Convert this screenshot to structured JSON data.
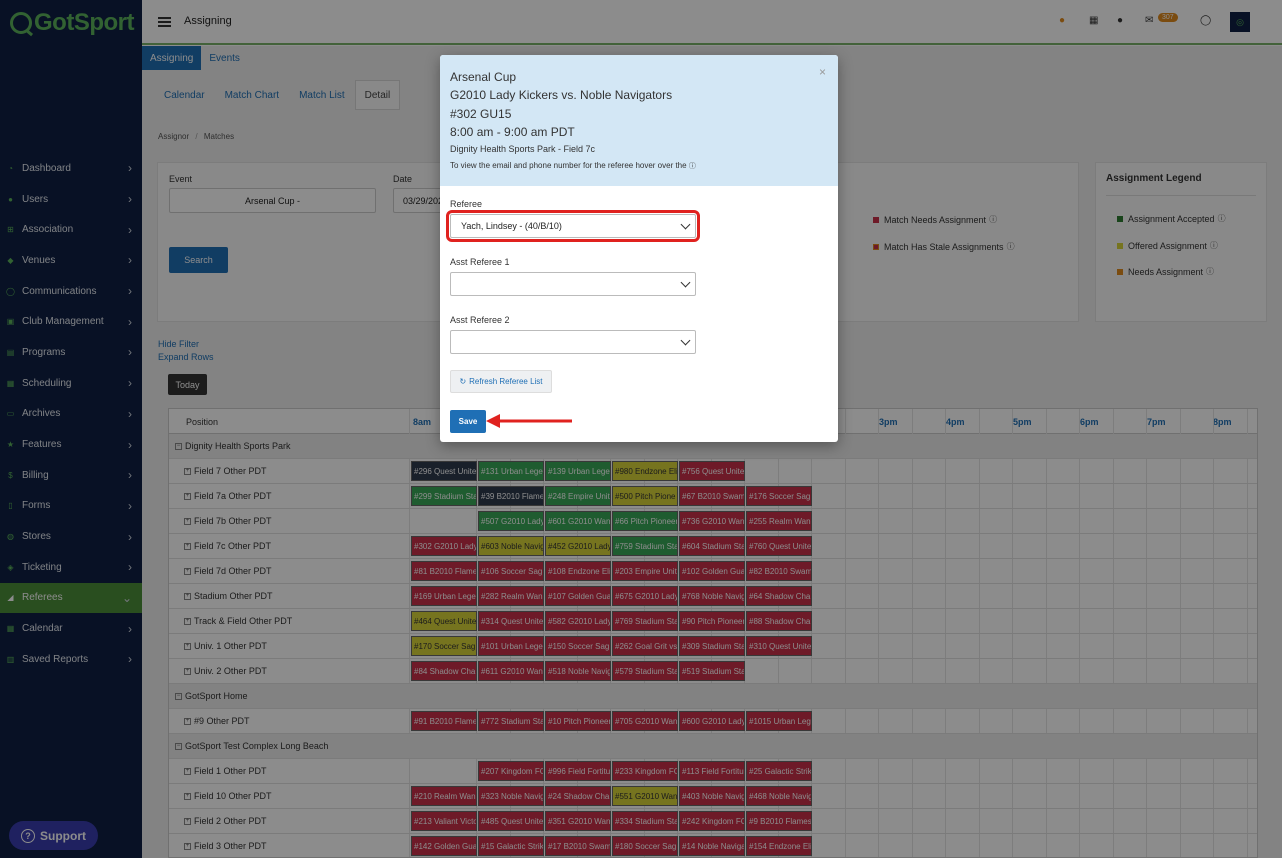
{
  "app": {
    "logo": "GotSport",
    "page_title": "Assigning",
    "notification_count": "307"
  },
  "sidebar": {
    "items": [
      {
        "label": "Dashboard",
        "icon": "speedometer-icon"
      },
      {
        "label": "Users",
        "icon": "users-icon"
      },
      {
        "label": "Association",
        "icon": "sitemap-icon"
      },
      {
        "label": "Venues",
        "icon": "map-icon"
      },
      {
        "label": "Communications",
        "icon": "chat-icon"
      },
      {
        "label": "Club Management",
        "icon": "building-icon"
      },
      {
        "label": "Programs",
        "icon": "document-icon"
      },
      {
        "label": "Scheduling",
        "icon": "calendar-icon"
      },
      {
        "label": "Archives",
        "icon": "archive-icon"
      },
      {
        "label": "Features",
        "icon": "star-icon"
      },
      {
        "label": "Billing",
        "icon": "dollar-icon"
      },
      {
        "label": "Forms",
        "icon": "file-icon"
      },
      {
        "label": "Stores",
        "icon": "cart-icon"
      },
      {
        "label": "Ticketing",
        "icon": "ticket-icon"
      },
      {
        "label": "Referees",
        "icon": "whistle-icon",
        "active": true
      },
      {
        "label": "Calendar",
        "icon": "calendar-icon"
      },
      {
        "label": "Saved Reports",
        "icon": "report-icon"
      }
    ],
    "support": "Support"
  },
  "subtabs": [
    "Assigning",
    "Events"
  ],
  "tabs": [
    "Calendar",
    "Match Chart",
    "Match List",
    "Detail"
  ],
  "breadcrumb": [
    "Assignor",
    "Matches"
  ],
  "filters": {
    "event_label": "Event",
    "event_value": "Arsenal Cup -",
    "date_label": "Date",
    "date_value": "03/29/202",
    "search": "Search",
    "legend": [
      "Match Needs Assignment",
      "Match Has Stale Assignments"
    ]
  },
  "assignment_legend": {
    "title": "Assignment Legend",
    "items": [
      {
        "label": "Assignment Accepted",
        "color": "#2e7d32"
      },
      {
        "label": "Offered Assignment",
        "color": "#d8d43a"
      },
      {
        "label": "Needs Assignment",
        "color": "#e08a1e"
      }
    ]
  },
  "links": {
    "hide_filter": "Hide Filter",
    "expand_rows": "Expand Rows",
    "today": "Today"
  },
  "grid": {
    "position_header": "Position",
    "hours": [
      "8am",
      "3pm",
      "4pm",
      "5pm",
      "6pm",
      "7pm",
      "8pm"
    ],
    "rows": [
      {
        "label": "Dignity Health Sports Park",
        "group": true
      },
      {
        "label": "Field 7 Other PDT",
        "cells": [
          {
            "t": "#296 Quest Unite",
            "c": "dark"
          },
          {
            "t": "#131 Urban Lege",
            "c": "green"
          },
          {
            "t": "#139 Urban Lege",
            "c": "green"
          },
          {
            "t": "#980 Endzone Eli",
            "c": "yellow"
          },
          {
            "t": "#756 Quest Unite",
            "c": "red"
          }
        ]
      },
      {
        "label": "Field 7a Other PDT",
        "cells": [
          {
            "t": "#299 Stadium Sta",
            "c": "green"
          },
          {
            "t": "#39 B2010 Flame",
            "c": "dark"
          },
          {
            "t": "#248 Empire Unit",
            "c": "green"
          },
          {
            "t": "#500 Pitch Pione",
            "c": "yellow"
          },
          {
            "t": "#67 B2010 Swam",
            "c": "red"
          },
          {
            "t": "#176 Soccer Sag",
            "c": "red"
          }
        ]
      },
      {
        "label": "Field 7b Other PDT",
        "cells": [
          {
            "t": "",
            "c": ""
          },
          {
            "t": "#507 G2010 Lady",
            "c": "green"
          },
          {
            "t": "#601 G2010 Wan",
            "c": "green"
          },
          {
            "t": "#66 Pitch Pioneer",
            "c": "green"
          },
          {
            "t": "#736 G2010 Wan",
            "c": "red"
          },
          {
            "t": "#255 Realm Wan",
            "c": "red"
          }
        ]
      },
      {
        "label": "Field 7c Other PDT",
        "cells": [
          {
            "t": "#302 G2010 Lady",
            "c": "red"
          },
          {
            "t": "#603 Noble Navig",
            "c": "yellow"
          },
          {
            "t": "#452 G2010 Lady",
            "c": "yellow"
          },
          {
            "t": "#759 Stadium Sta",
            "c": "green"
          },
          {
            "t": "#604 Stadium Sta",
            "c": "red"
          },
          {
            "t": "#760 Quest Unite",
            "c": "red"
          }
        ]
      },
      {
        "label": "Field 7d Other PDT",
        "cells": [
          {
            "t": "#81 B2010 Flame",
            "c": "red"
          },
          {
            "t": "#106 Soccer Sag",
            "c": "red"
          },
          {
            "t": "#108 Endzone Eli",
            "c": "red"
          },
          {
            "t": "#203 Empire Unit",
            "c": "red"
          },
          {
            "t": "#102 Golden Gua",
            "c": "red"
          },
          {
            "t": "#82 B2010 Swam",
            "c": "red"
          }
        ]
      },
      {
        "label": "Stadium Other PDT",
        "cells": [
          {
            "t": "#169 Urban Lege",
            "c": "red"
          },
          {
            "t": "#282 Realm Wan",
            "c": "red"
          },
          {
            "t": "#107 Golden Gua",
            "c": "red"
          },
          {
            "t": "#675 G2010 Lady",
            "c": "red"
          },
          {
            "t": "#768 Noble Navig",
            "c": "red"
          },
          {
            "t": "#64 Shadow Cha",
            "c": "red"
          }
        ]
      },
      {
        "label": "Track & Field Other PDT",
        "cells": [
          {
            "t": "#464 Quest Unite",
            "c": "yellow"
          },
          {
            "t": "#314 Quest Unite",
            "c": "red"
          },
          {
            "t": "#582 G2010 Lady",
            "c": "red"
          },
          {
            "t": "#769 Stadium Sta",
            "c": "red"
          },
          {
            "t": "#90 Pitch Pioneer",
            "c": "red"
          },
          {
            "t": "#88 Shadow Cha",
            "c": "red"
          }
        ]
      },
      {
        "label": "Univ. 1 Other PDT",
        "cells": [
          {
            "t": "#170 Soccer Sag",
            "c": "yellow"
          },
          {
            "t": "#101 Urban Lege",
            "c": "red"
          },
          {
            "t": "#150 Soccer Sag",
            "c": "red"
          },
          {
            "t": "#262 Goal Grit vs",
            "c": "red"
          },
          {
            "t": "#309 Stadium Sta",
            "c": "red"
          },
          {
            "t": "#310 Quest Unite",
            "c": "red"
          }
        ]
      },
      {
        "label": "Univ. 2 Other PDT",
        "cells": [
          {
            "t": "#84 Shadow Cha",
            "c": "red"
          },
          {
            "t": "#611 G2010 Wan",
            "c": "red"
          },
          {
            "t": "#518 Noble Navig",
            "c": "red"
          },
          {
            "t": "#579 Stadium Sta",
            "c": "red"
          },
          {
            "t": "#519 Stadium Sta",
            "c": "red"
          }
        ]
      },
      {
        "label": "GotSport Home",
        "group": true
      },
      {
        "label": "#9 Other PDT",
        "cells": [
          {
            "t": "#91 B2010 Flame",
            "c": "red"
          },
          {
            "t": "#772 Stadium Sta",
            "c": "red"
          },
          {
            "t": "#10 Pitch Pioneer",
            "c": "red"
          },
          {
            "t": "#705 G2010 Wan",
            "c": "red"
          },
          {
            "t": "#600 G2010 Lady",
            "c": "red"
          },
          {
            "t": "#1015 Urban Leg",
            "c": "red"
          }
        ]
      },
      {
        "label": "GotSport Test Complex Long Beach",
        "group": true
      },
      {
        "label": "Field 1 Other PDT",
        "cells": [
          {
            "t": "",
            "c": ""
          },
          {
            "t": "#207 Kingdom FC",
            "c": "red"
          },
          {
            "t": "#996 Field Fortitu",
            "c": "red"
          },
          {
            "t": "#233 Kingdom FC",
            "c": "red"
          },
          {
            "t": "#113 Field Fortitu",
            "c": "red"
          },
          {
            "t": "#25 Galactic Strik",
            "c": "red"
          }
        ]
      },
      {
        "label": "Field 10 Other PDT",
        "cells": [
          {
            "t": "#210 Realm Wan",
            "c": "red"
          },
          {
            "t": "#323 Noble Navig",
            "c": "red"
          },
          {
            "t": "#24 Shadow Cha",
            "c": "red"
          },
          {
            "t": "#551 G2010 Wan",
            "c": "yellow"
          },
          {
            "t": "#403 Noble Navig",
            "c": "red"
          },
          {
            "t": "#468 Noble Navig",
            "c": "red"
          }
        ]
      },
      {
        "label": "Field 2 Other PDT",
        "cells": [
          {
            "t": "#213 Valiant Victo",
            "c": "red"
          },
          {
            "t": "#485 Quest Unite",
            "c": "red"
          },
          {
            "t": "#351 G2010 Wan",
            "c": "red"
          },
          {
            "t": "#334 Stadium Sta",
            "c": "red"
          },
          {
            "t": "#242 Kingdom FC",
            "c": "red"
          },
          {
            "t": "#9 B2010 Flames",
            "c": "red"
          }
        ]
      },
      {
        "label": "Field 3 Other PDT",
        "cells": [
          {
            "t": "#142 Golden Gua",
            "c": "red"
          },
          {
            "t": "#15 Galactic Strik",
            "c": "red"
          },
          {
            "t": "#17 B2010 Swam",
            "c": "red"
          },
          {
            "t": "#180 Soccer Sag",
            "c": "red"
          },
          {
            "t": "#14 Noble Naviga",
            "c": "red"
          },
          {
            "t": "#154 Endzone Eli",
            "c": "red"
          }
        ]
      }
    ]
  },
  "modal": {
    "event": "Arsenal Cup",
    "match": "G2010 Lady Kickers vs. Noble Navigators",
    "game": "#302 GU15",
    "time": "8:00 am - 9:00 am PDT",
    "venue": "Dignity Health Sports Park - Field 7c",
    "hint": "To view the email and phone number for the referee hover over the",
    "referee_label": "Referee",
    "referee_value": "Yach, Lindsey - (40/B/10)",
    "ar1_label": "Asst Referee 1",
    "ar1_value": "",
    "ar2_label": "Asst Referee 2",
    "ar2_value": "",
    "refresh": "Refresh Referee List",
    "save": "Save"
  }
}
